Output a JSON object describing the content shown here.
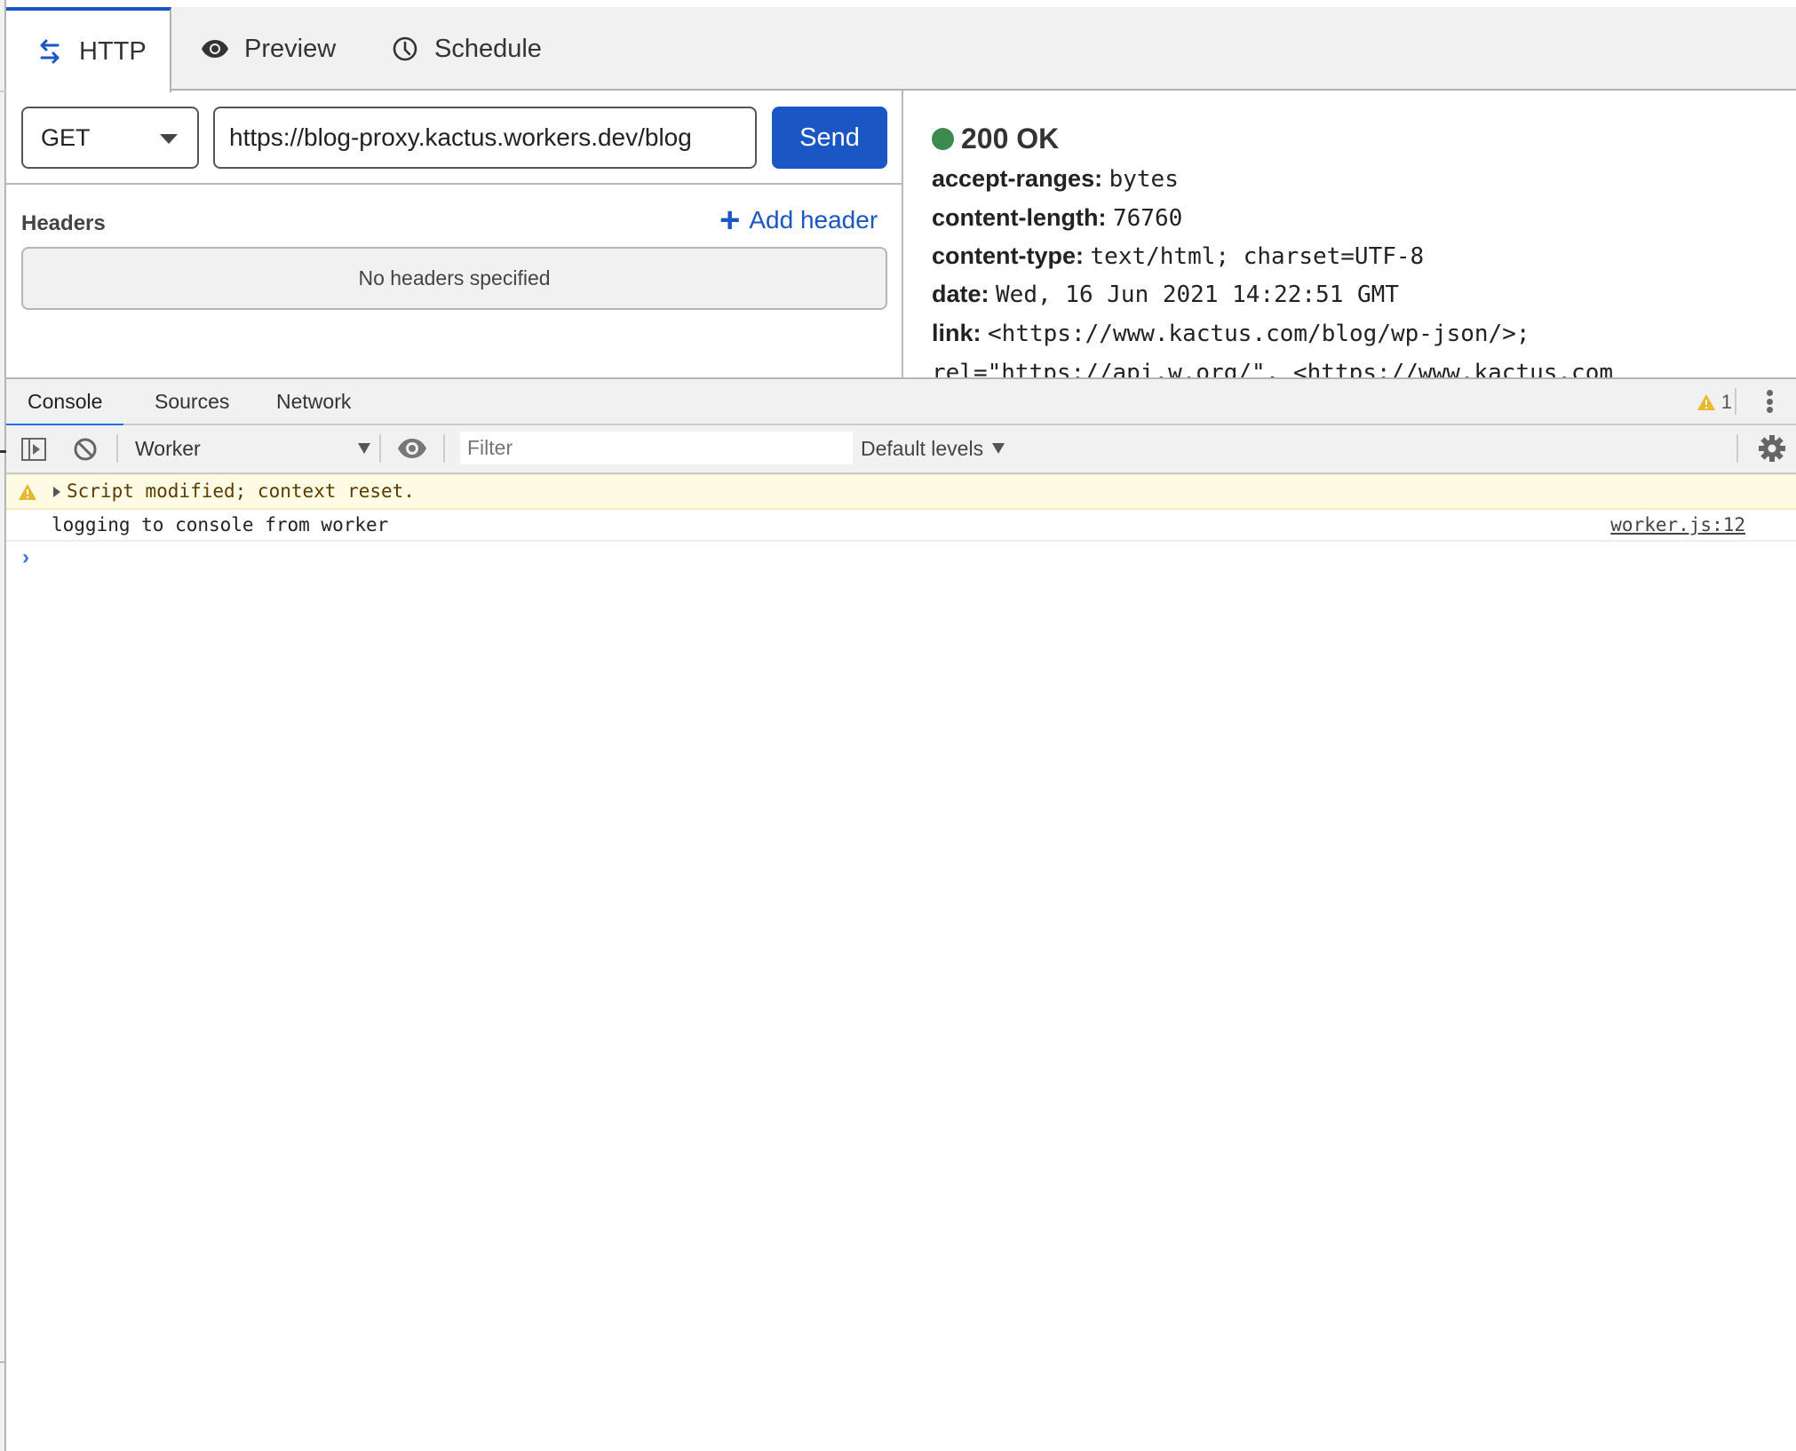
{
  "top_tabs": [
    {
      "label": "HTTP",
      "icon": "arrows-left-right-icon",
      "active": true
    },
    {
      "label": "Preview",
      "icon": "eye-icon",
      "active": false
    },
    {
      "label": "Schedule",
      "icon": "clock-icon",
      "active": false
    }
  ],
  "request": {
    "method": "GET",
    "url": "https://blog-proxy.kactus.workers.dev/blog",
    "send_label": "Send",
    "headers_label": "Headers",
    "add_header_label": "Add header",
    "no_headers_text": "No headers specified"
  },
  "response": {
    "status": "200 OK",
    "status_color": "#3c8a4f",
    "headers": [
      {
        "key": "accept-ranges:",
        "value": "bytes"
      },
      {
        "key": "content-length:",
        "value": "76760"
      },
      {
        "key": "content-type:",
        "value": "text/html; charset=UTF-8"
      },
      {
        "key": "date:",
        "value": "Wed, 16 Jun 2021 14:22:51 GMT"
      },
      {
        "key": "link:",
        "value": "<https://www.kactus.com/blog/wp-json/>;"
      }
    ],
    "overflow_line": "rel=\"https://api.w.org/\", <https://www.kactus.com"
  },
  "devtools": {
    "tabs": [
      {
        "label": "Console",
        "active": true
      },
      {
        "label": "Sources",
        "active": false
      },
      {
        "label": "Network",
        "active": false
      }
    ],
    "warning_count": "1",
    "context": "Worker",
    "filter_placeholder": "Filter",
    "levels": "Default levels",
    "messages": [
      {
        "type": "warning",
        "text": "Script modified; context reset."
      },
      {
        "type": "log",
        "text": "logging to console from worker",
        "source": "worker.js:12"
      }
    ],
    "accent": "#1a73e8"
  },
  "colors": {
    "primary": "#1a56c4",
    "warning_bg": "#fefbe5",
    "warning_icon": "#e8b82e"
  }
}
